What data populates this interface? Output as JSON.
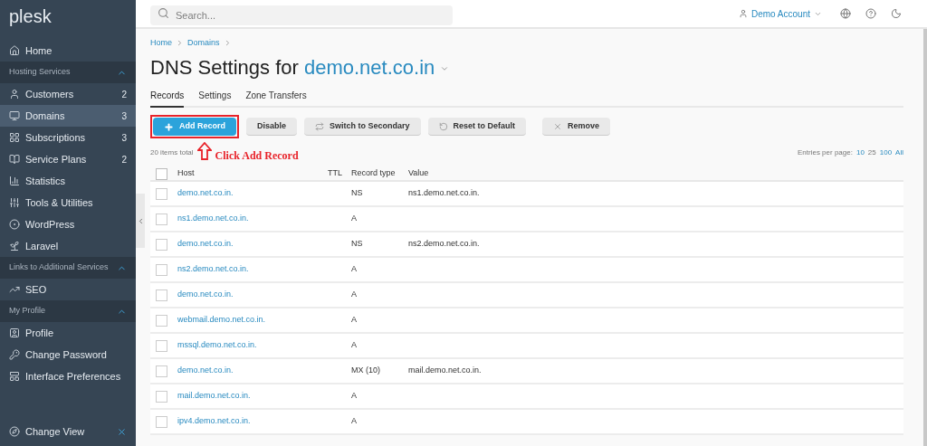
{
  "sidebar": {
    "logo": "plesk",
    "items": [
      {
        "kind": "item",
        "label": "Home",
        "selected": false
      },
      {
        "kind": "section",
        "label": "Hosting Services",
        "expanded": true
      },
      {
        "kind": "item",
        "label": "Customers",
        "count": "2",
        "selected": false
      },
      {
        "kind": "item",
        "label": "Domains",
        "count": "3",
        "selected": true
      },
      {
        "kind": "item",
        "label": "Subscriptions",
        "count": "3",
        "selected": false
      },
      {
        "kind": "item",
        "label": "Service Plans",
        "count": "2",
        "selected": false
      },
      {
        "kind": "item",
        "label": "Statistics",
        "selected": false
      },
      {
        "kind": "item",
        "label": "Tools & Utilities",
        "selected": false
      },
      {
        "kind": "item",
        "label": "WordPress",
        "selected": false
      },
      {
        "kind": "item",
        "label": "Laravel",
        "selected": false
      },
      {
        "kind": "section",
        "label": "Links to Additional Services",
        "expanded": true
      },
      {
        "kind": "item",
        "label": "SEO",
        "selected": false
      },
      {
        "kind": "section",
        "label": "My Profile",
        "expanded": true
      },
      {
        "kind": "item",
        "label": "Profile",
        "selected": false
      },
      {
        "kind": "item",
        "label": "Change Password",
        "selected": false
      },
      {
        "kind": "item",
        "label": "Interface Preferences",
        "selected": false
      }
    ],
    "footer": "Change View"
  },
  "topbar": {
    "search_placeholder": "Search...",
    "account": "Demo Account"
  },
  "breadcrumbs": [
    "Home",
    "Domains"
  ],
  "title": {
    "prefix": "DNS Settings for",
    "domain": "demo.net.co.in"
  },
  "tabs": [
    {
      "label": "Records",
      "selected": true
    },
    {
      "label": "Settings",
      "selected": false
    },
    {
      "label": "Zone Transfers",
      "selected": false
    }
  ],
  "toolbar": [
    {
      "label": "Add Record",
      "kind": "primary"
    },
    {
      "label": "Disable",
      "kind": "plain"
    },
    {
      "label": "Switch to Secondary",
      "kind": "switch"
    },
    {
      "label": "Reset to Default",
      "kind": "reset"
    },
    {
      "label": "Remove",
      "kind": "remove"
    }
  ],
  "annotation": {
    "text": "Click Add Record"
  },
  "items_total": "20 items total",
  "entries_per_page": {
    "label": "Entries per page:",
    "options": [
      {
        "label": "10",
        "selected": false
      },
      {
        "label": "25",
        "selected": true
      },
      {
        "label": "100",
        "selected": false
      },
      {
        "label": "All",
        "selected": false
      }
    ]
  },
  "table": {
    "columns": [
      "Host",
      "TTL",
      "Record type",
      "Value"
    ],
    "rows": [
      {
        "host": "demo.net.co.in.",
        "type": "NS",
        "value": "ns1.demo.net.co.in.",
        "checked": false
      },
      {
        "host": "ns1.demo.net.co.in.",
        "type": "A",
        "checked": false
      },
      {
        "host": "demo.net.co.in.",
        "type": "NS",
        "value": "ns2.demo.net.co.in.",
        "checked": false
      },
      {
        "host": "ns2.demo.net.co.in.",
        "type": "A",
        "checked": false
      },
      {
        "host": "demo.net.co.in.",
        "type": "A",
        "checked": false
      },
      {
        "host": "webmail.demo.net.co.in.",
        "type": "A",
        "checked": false
      },
      {
        "host": "mssql.demo.net.co.in.",
        "type": "A",
        "checked": false
      },
      {
        "host": "demo.net.co.in.",
        "type": "MX (10)",
        "value": "mail.demo.net.co.in.",
        "checked": false
      },
      {
        "host": "mail.demo.net.co.in.",
        "type": "A",
        "checked": false
      },
      {
        "host": "ipv4.demo.net.co.in.",
        "type": "A",
        "checked": false
      }
    ],
    "select_all_checked": false
  }
}
